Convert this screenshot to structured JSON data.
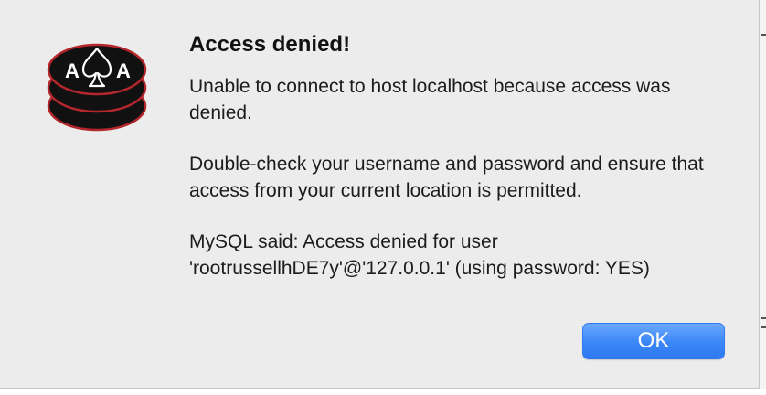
{
  "dialog": {
    "title": "Access denied!",
    "message_line1": "Unable to connect to host localhost because access was denied.",
    "message_line2": "Double-check your username and password and ensure that access from your current location is permitted.",
    "message_line3": "MySQL said: Access denied for user 'rootrussellhDE7y'@'127.0.0.1' (using password: YES)",
    "ok_label": "OK"
  },
  "app_icon": {
    "name": "database-ace-icon",
    "left_letter": "A",
    "right_letter": "A",
    "colors": {
      "disk": "#111111",
      "outline": "#b3262b",
      "glyph": "#ffffff"
    }
  },
  "colors": {
    "dialog_background": "#ececec",
    "button_accent": "#3b86f7",
    "button_text": "#ffffff"
  }
}
